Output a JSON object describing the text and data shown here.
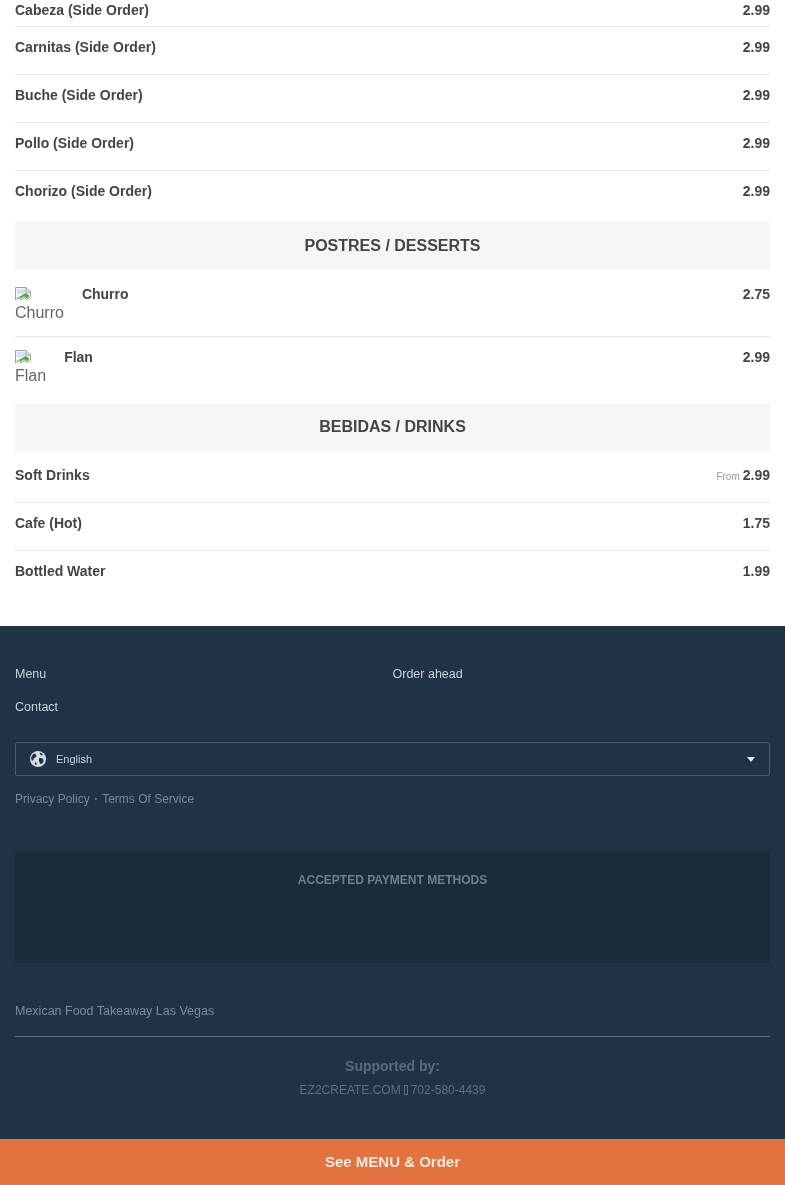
{
  "menu_sections": [
    {
      "items": [
        {
          "name": "Cabeza (Side Order)",
          "price": "2.99"
        },
        {
          "name": "Carnitas (Side Order)",
          "price": "2.99"
        },
        {
          "name": "Buche (Side Order)",
          "price": "2.99"
        },
        {
          "name": "Pollo (Side Order)",
          "price": "2.99"
        },
        {
          "name": "Chorizo (Side Order)",
          "price": "2.99"
        }
      ]
    },
    {
      "title": "POSTRES / DESSERTS",
      "items": [
        {
          "name": "Churro",
          "price": "2.75",
          "image_alt": "Churro"
        },
        {
          "name": "Flan",
          "price": "2.99",
          "image_alt": "Flan"
        }
      ]
    },
    {
      "title": "BEBIDAS / DRINKS",
      "items": [
        {
          "name": "Soft Drinks",
          "price_prefix": "From",
          "price": "2.99"
        },
        {
          "name": "Cafe (Hot)",
          "price": "1.75"
        },
        {
          "name": "Bottled Water",
          "price": "1.99"
        }
      ]
    }
  ],
  "footer": {
    "links": [
      "Menu",
      "Order ahead",
      "Contact"
    ],
    "language_select": {
      "value": "English"
    },
    "legal_links": [
      "Privacy Policy",
      "Terms Of Service"
    ],
    "legal_separator": "•",
    "payment_methods": {
      "title": "ACCEPTED PAYMENT METHODS"
    },
    "tagline": "Mexican Food Takeaway Las Vegas",
    "supported_by": {
      "label": "Supported by:",
      "site": "EZ2CREATE.COM",
      "phone": "702-580-4439"
    }
  },
  "order_button": {
    "label": "See MENU & Order"
  }
}
